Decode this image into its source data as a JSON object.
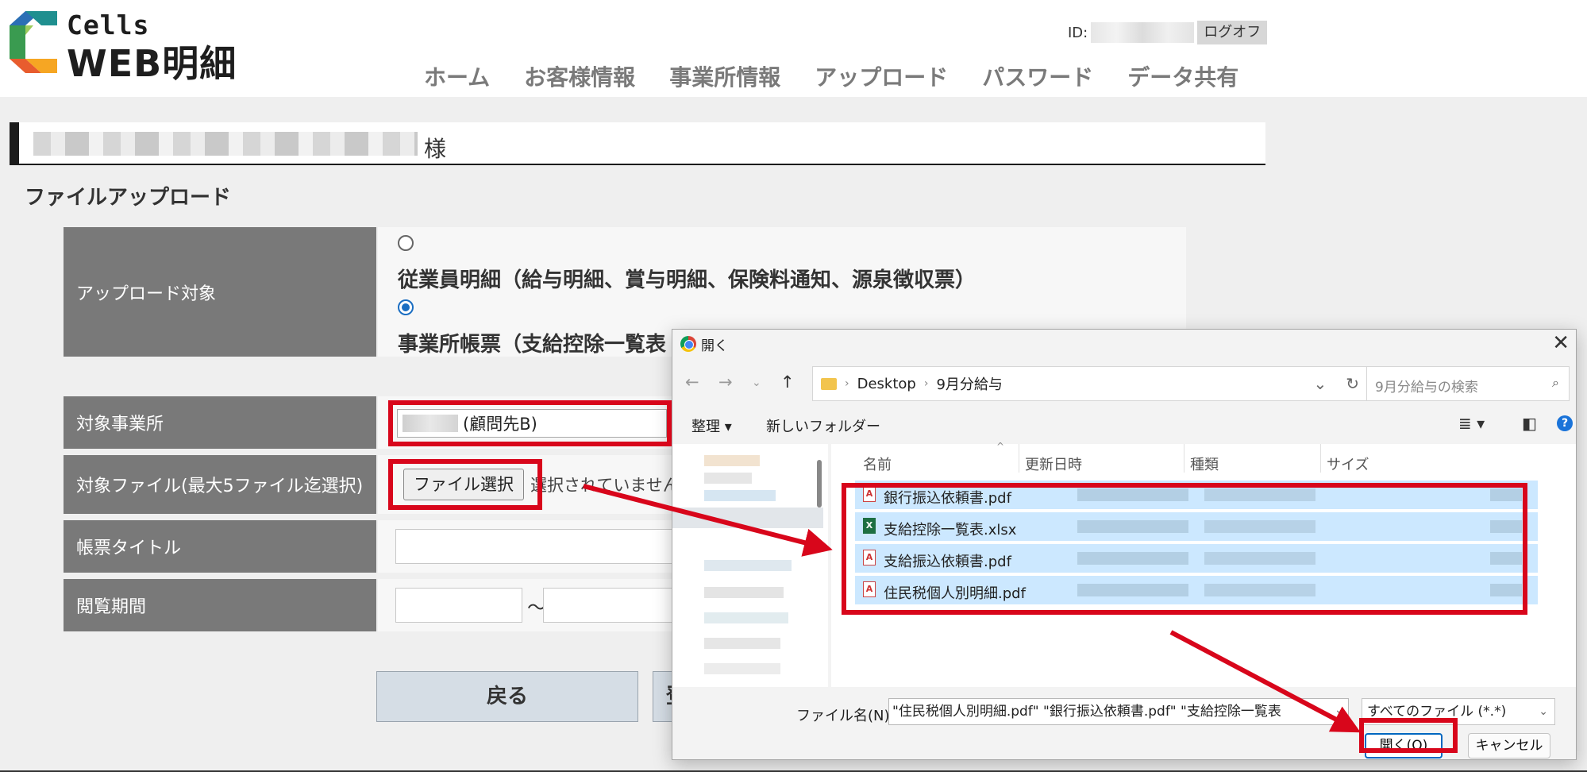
{
  "header": {
    "logo_top": "Cells",
    "logo_main": "WEB明細",
    "id_label": "ID:",
    "logoff": "ログオフ",
    "nav": [
      "ホーム",
      "お客様情報",
      "事業所情報",
      "アップロード",
      "パスワード",
      "データ共有"
    ]
  },
  "customer": {
    "suffix": "様"
  },
  "section_title": "ファイルアップロード",
  "form": {
    "upload_target_label": "アップロード対象",
    "option1": "従業員明細（給与明細、賞与明細、保険料通知、源泉徴収票）",
    "option2": "事業所帳票（支給控除一覧表",
    "selected_option": 2,
    "office_label": "対象事業所",
    "office_value": "(顧問先B)",
    "file_label": "対象ファイル(最大5ファイル迄選択)",
    "file_button": "ファイル選択",
    "file_status": "選択されていません",
    "title_label": "帳票タイトル",
    "period_label": "閲覧期間",
    "period_sep": "～",
    "back_button": "戻る",
    "next_button_partial": "登"
  },
  "dialog": {
    "title": "開く",
    "breadcrumb": [
      "Desktop",
      "9月分給与"
    ],
    "search_placeholder": "9月分給与の検索",
    "organize": "整理",
    "new_folder": "新しいフォルダー",
    "columns": [
      "名前",
      "更新日時",
      "種類",
      "サイズ"
    ],
    "files": [
      {
        "name": "銀行振込依頼書.pdf",
        "icon": "pdf-icon"
      },
      {
        "name": "支給控除一覧表.xlsx",
        "icon": "excel-icon"
      },
      {
        "name": "支給振込依頼書.pdf",
        "icon": "pdf-icon"
      },
      {
        "name": "住民税個人別明細.pdf",
        "icon": "pdf-icon"
      }
    ],
    "filename_label": "ファイル名(N):",
    "filename_value": "\"住民税個人別明細.pdf\" \"銀行振込依頼書.pdf\" \"支給控除一覧表",
    "filetype": "すべてのファイル (*.*)",
    "open_button": "開く(O)",
    "cancel_button": "キャンセル"
  },
  "colors": {
    "accent_red": "#d8061b",
    "label_gray": "#797979",
    "selection_blue": "#cce8ff",
    "logo_colors": [
      "#3a9b50",
      "#2b6fb5",
      "#e85c2e",
      "#f6a623"
    ]
  }
}
